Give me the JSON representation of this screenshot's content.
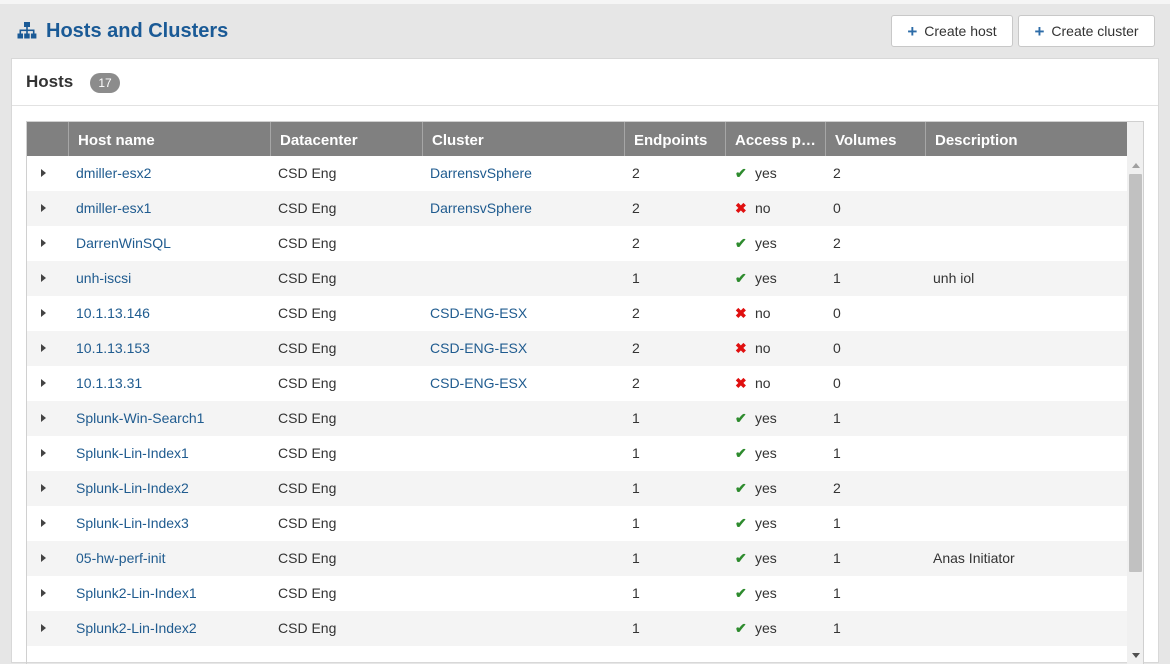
{
  "header": {
    "title": "Hosts and Clusters",
    "icon": "hierarchy-icon",
    "buttons": [
      {
        "label": "Create host",
        "icon": "plus-icon"
      },
      {
        "label": "Create cluster",
        "icon": "plus-icon"
      }
    ]
  },
  "panel": {
    "title": "Hosts",
    "count": "17"
  },
  "table": {
    "columns": [
      "",
      "Host name",
      "Datacenter",
      "Cluster",
      "Endpoints",
      "Access p…",
      "Volumes",
      "Description"
    ],
    "rows": [
      {
        "host": "dmiller-esx2",
        "datacenter": "CSD Eng",
        "cluster": "DarrensvSphere",
        "endpoints": "2",
        "access": "yes",
        "volumes": "2",
        "description": ""
      },
      {
        "host": "dmiller-esx1",
        "datacenter": "CSD Eng",
        "cluster": "DarrensvSphere",
        "endpoints": "2",
        "access": "no",
        "volumes": "0",
        "description": ""
      },
      {
        "host": "DarrenWinSQL",
        "datacenter": "CSD Eng",
        "cluster": "",
        "endpoints": "2",
        "access": "yes",
        "volumes": "2",
        "description": ""
      },
      {
        "host": "unh-iscsi",
        "datacenter": "CSD Eng",
        "cluster": "",
        "endpoints": "1",
        "access": "yes",
        "volumes": "1",
        "description": "unh iol"
      },
      {
        "host": "10.1.13.146",
        "datacenter": "CSD Eng",
        "cluster": "CSD-ENG-ESX",
        "endpoints": "2",
        "access": "no",
        "volumes": "0",
        "description": ""
      },
      {
        "host": "10.1.13.153",
        "datacenter": "CSD Eng",
        "cluster": "CSD-ENG-ESX",
        "endpoints": "2",
        "access": "no",
        "volumes": "0",
        "description": ""
      },
      {
        "host": "10.1.13.31",
        "datacenter": "CSD Eng",
        "cluster": "CSD-ENG-ESX",
        "endpoints": "2",
        "access": "no",
        "volumes": "0",
        "description": ""
      },
      {
        "host": "Splunk-Win-Search1",
        "datacenter": "CSD Eng",
        "cluster": "",
        "endpoints": "1",
        "access": "yes",
        "volumes": "1",
        "description": ""
      },
      {
        "host": "Splunk-Lin-Index1",
        "datacenter": "CSD Eng",
        "cluster": "",
        "endpoints": "1",
        "access": "yes",
        "volumes": "1",
        "description": ""
      },
      {
        "host": "Splunk-Lin-Index2",
        "datacenter": "CSD Eng",
        "cluster": "",
        "endpoints": "1",
        "access": "yes",
        "volumes": "2",
        "description": ""
      },
      {
        "host": "Splunk-Lin-Index3",
        "datacenter": "CSD Eng",
        "cluster": "",
        "endpoints": "1",
        "access": "yes",
        "volumes": "1",
        "description": ""
      },
      {
        "host": "05-hw-perf-init",
        "datacenter": "CSD Eng",
        "cluster": "",
        "endpoints": "1",
        "access": "yes",
        "volumes": "1",
        "description": "Anas Initiator"
      },
      {
        "host": "Splunk2-Lin-Index1",
        "datacenter": "CSD Eng",
        "cluster": "",
        "endpoints": "1",
        "access": "yes",
        "volumes": "1",
        "description": ""
      },
      {
        "host": "Splunk2-Lin-Index2",
        "datacenter": "CSD Eng",
        "cluster": "",
        "endpoints": "1",
        "access": "yes",
        "volumes": "1",
        "description": ""
      }
    ]
  },
  "colors": {
    "title": "#1a5a96",
    "link": "#1f5b8f",
    "header_bg": "#808080",
    "ok": "#2e8b2e",
    "bad": "#e01010"
  }
}
